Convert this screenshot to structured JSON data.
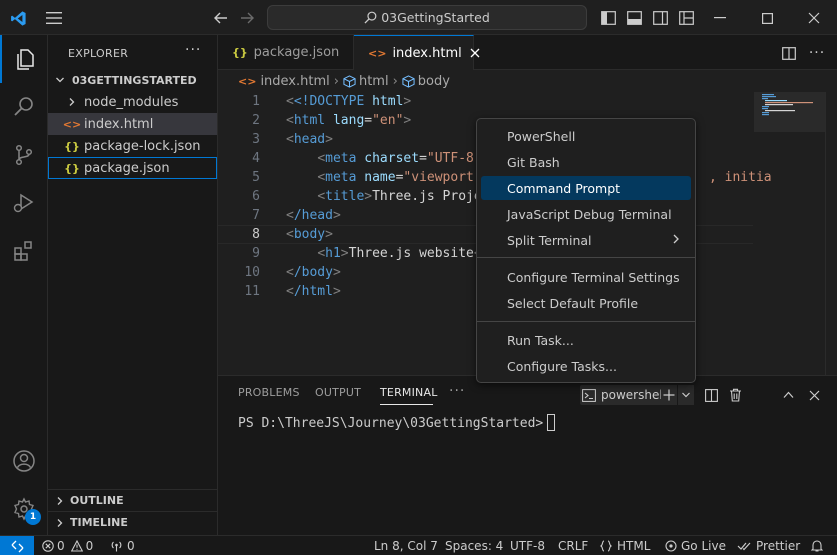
{
  "titlebar": {
    "search_text": "03GettingStarted"
  },
  "sidebar": {
    "title": "EXPLORER",
    "more": "···",
    "root": "03GETTINGSTARTED",
    "items": [
      {
        "label": "node_modules",
        "icon": "chevron-right-icon"
      },
      {
        "label": "index.html",
        "icon": "html-file-icon",
        "glyph": "<>"
      },
      {
        "label": "package-lock.json",
        "icon": "json-file-icon",
        "glyph": "{}"
      },
      {
        "label": "package.json",
        "icon": "json-file-icon",
        "glyph": "{}"
      }
    ],
    "outline": "OUTLINE",
    "timeline": "TIMELINE"
  },
  "tabs": [
    {
      "label": "package.json",
      "glyph": "{}"
    },
    {
      "label": "index.html",
      "glyph": "<>"
    }
  ],
  "breadcrumb": {
    "file": "index.html",
    "node1": "html",
    "node2": "body"
  },
  "editor": {
    "lines": [
      "1",
      "2",
      "3",
      "4",
      "5",
      "6",
      "7",
      "8",
      "9",
      "10",
      "11"
    ],
    "current_line": "8",
    "code": {
      "l1_doctype": "<!DOCTYPE",
      "l1_html": "html",
      "l2_tag": "html",
      "l2_attr": "lang",
      "l2_val": "\"en\"",
      "l3_tag": "head",
      "l4_tag": "meta",
      "l4_attr": "charset",
      "l4_val": "\"UTF-8\"",
      "l5_tag": "meta",
      "l5_attr": "name",
      "l5_val": "\"viewport\"",
      "l5_rest": ", initia",
      "l6_tag": "title",
      "l6_text": "Three.js Proje",
      "l7_tag": "/head",
      "l8_tag": "body",
      "l9_tag": "h1",
      "l9_text": "Three.js website",
      "l10_tag": "/body",
      "l11_tag": "/html"
    }
  },
  "panel": {
    "tabs": [
      "PROBLEMS",
      "OUTPUT",
      "TERMINAL"
    ],
    "more": "···",
    "terminal_name": "powershell",
    "prompt": "PS D:\\ThreeJS\\Journey\\03GettingStarted>"
  },
  "menu": {
    "items": [
      "PowerShell",
      "Git Bash",
      "Command Prompt",
      "JavaScript Debug Terminal",
      "Split Terminal",
      "Configure Terminal Settings",
      "Select Default Profile",
      "Run Task...",
      "Configure Tasks..."
    ]
  },
  "statusbar": {
    "errors": "0",
    "warnings": "0",
    "ports": "0",
    "position": "Ln 8, Col 7",
    "spaces": "Spaces: 4",
    "encoding": "UTF-8",
    "eol": "CRLF",
    "language": "HTML",
    "golive": "Go Live",
    "prettier": "Prettier"
  },
  "notifications_badge": "1",
  "colors": {
    "accent": "#0078d4",
    "html_icon": "#e37933",
    "json_icon": "#cbcb41",
    "menu_highlight": "#04395e"
  }
}
